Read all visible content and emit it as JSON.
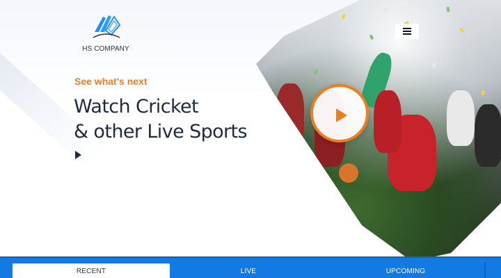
{
  "brand": {
    "name": "HS COMPANY",
    "logo_icon": "hs-company-logo",
    "accent": "#f07d1d",
    "primary": "#1379e3"
  },
  "hero": {
    "eyebrow": "See what's next",
    "headline_line1": "Watch Cricket",
    "headline_line2": "& other Live Sports",
    "cta_icon": "play-icon",
    "image": "sports-players-celebration-photo"
  },
  "header": {
    "menu_icon": "hamburger-menu-icon"
  },
  "video": {
    "play_icon": "play-circle-icon"
  },
  "tabs": [
    {
      "label": "RECENT",
      "active": true
    },
    {
      "label": "LIVE",
      "active": false
    },
    {
      "label": "UPCOMING",
      "active": false
    }
  ]
}
